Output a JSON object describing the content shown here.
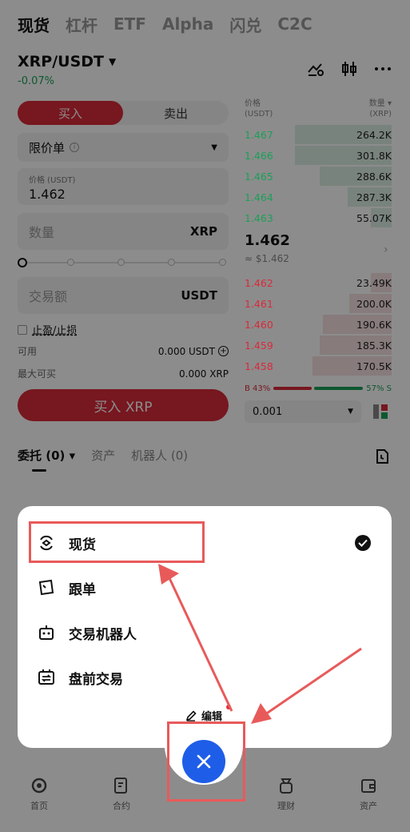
{
  "nav": {
    "tabs": [
      {
        "label": "现货",
        "active": true
      },
      {
        "label": "杠杆",
        "active": false
      },
      {
        "label": "ETF",
        "active": false
      },
      {
        "label": "Alpha",
        "active": false
      },
      {
        "label": "闪兑",
        "active": false
      },
      {
        "label": "C2C",
        "active": false
      }
    ]
  },
  "pair": {
    "symbol": "XRP/USDT",
    "change": "-0.07%"
  },
  "trade": {
    "buy_tab": "买入",
    "sell_tab": "卖出",
    "order_type": "限价单",
    "price_label": "价格 (USDT)",
    "price_value": "1.462",
    "qty_placeholder": "数量",
    "qty_unit": "XRP",
    "amount_placeholder": "交易额",
    "amount_unit": "USDT",
    "tpsl_label": "止盈/止损",
    "available_label": "可用",
    "available_value": "0.000 USDT",
    "maxbuy_label": "最大可买",
    "maxbuy_value": "0.000 XRP",
    "buy_button": "买入 XRP"
  },
  "orderbook": {
    "price_header": "价格",
    "price_unit": "(USDT)",
    "qty_header": "数量 ▾",
    "qty_unit": "(XRP)",
    "asks": [
      {
        "price": "1.467",
        "qty": "264.2K",
        "depth": 0.66
      },
      {
        "price": "1.466",
        "qty": "301.8K",
        "depth": 0.66
      },
      {
        "price": "1.465",
        "qty": "288.6K",
        "depth": 0.49
      },
      {
        "price": "1.464",
        "qty": "287.3K",
        "depth": 0.3
      },
      {
        "price": "1.463",
        "qty": "55.07K",
        "depth": 0.14
      }
    ],
    "mid_price": "1.462",
    "mid_usd": "≈ $1.462",
    "bids": [
      {
        "price": "1.462",
        "qty": "23.49K",
        "depth": 0.14
      },
      {
        "price": "1.461",
        "qty": "200.0K",
        "depth": 0.29
      },
      {
        "price": "1.460",
        "qty": "190.6K",
        "depth": 0.47
      },
      {
        "price": "1.459",
        "qty": "185.3K",
        "depth": 0.49
      },
      {
        "price": "1.458",
        "qty": "170.5K",
        "depth": 0.54
      }
    ],
    "buy_ratio": "B 43%",
    "sell_ratio": "57% S",
    "depth_value": "0.001"
  },
  "orders_tabs": [
    {
      "label": "委托 (0) ▾",
      "active": true
    },
    {
      "label": "资产",
      "active": false
    },
    {
      "label": "机器人 (0)",
      "active": false
    }
  ],
  "bottom_nav": [
    {
      "label": "首页"
    },
    {
      "label": "合约"
    },
    {
      "label": "理财"
    },
    {
      "label": "资产"
    }
  ],
  "menu": {
    "items": [
      {
        "label": "现货",
        "selected": true
      },
      {
        "label": "跟单"
      },
      {
        "label": "交易机器人"
      },
      {
        "label": "盘前交易"
      }
    ],
    "edit_label": "编辑"
  },
  "colors": {
    "buy_red": "#d92a3a",
    "up_green": "#1aa058",
    "close_blue": "#1e5de8",
    "annotation_red": "#e85a5a"
  }
}
